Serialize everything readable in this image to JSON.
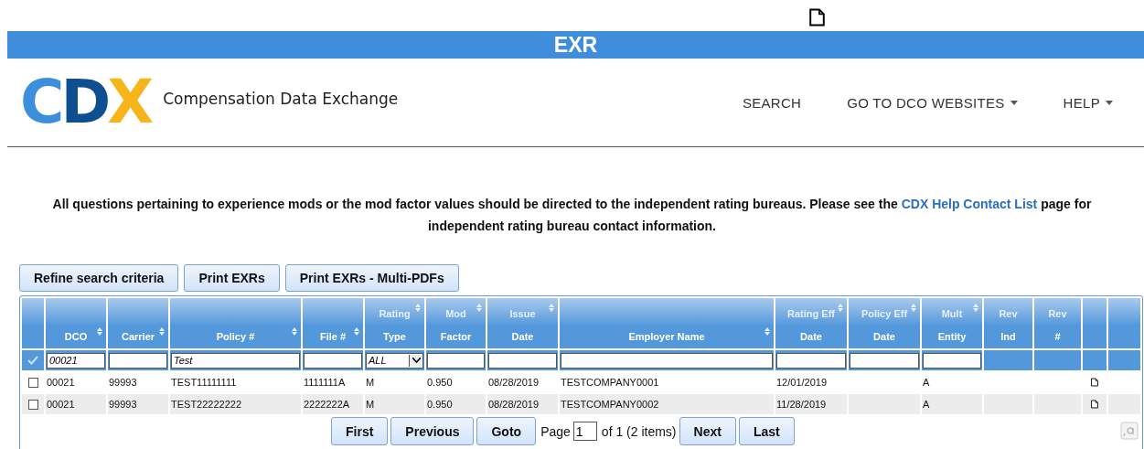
{
  "banner": {
    "title": "EXR"
  },
  "brand": {
    "logo": "CDX",
    "tagline": "Compensation Data Exchange"
  },
  "nav": [
    {
      "label": "SEARCH",
      "dropdown": false
    },
    {
      "label": "GO TO DCO WEBSITES",
      "dropdown": true
    },
    {
      "label": "HELP",
      "dropdown": true
    }
  ],
  "notice": {
    "before": "All questions pertaining to experience mods or the mod factor values should be directed to the independent rating bureaus. Please see the ",
    "link": "CDX Help Contact List",
    "after": " page for independent rating bureau contact information."
  },
  "actions": [
    "Refine search criteria",
    "Print EXRs",
    "Print EXRs - Multi-PDFs"
  ],
  "table": {
    "select_all": {
      "checked": true
    },
    "columns": [
      {
        "lines": [
          "DCO"
        ],
        "sortable": true,
        "filter": {
          "kind": "input",
          "value": "00021"
        }
      },
      {
        "lines": [
          "Carrier"
        ],
        "sortable": true,
        "filter": {
          "kind": "input"
        }
      },
      {
        "lines": [
          "Policy #"
        ],
        "sortable": true,
        "filter": {
          "kind": "input",
          "value": "Test"
        }
      },
      {
        "lines": [
          "File #"
        ],
        "sortable": true,
        "filter": {
          "kind": "input"
        }
      },
      {
        "lines": [
          "Rating",
          "Type"
        ],
        "sortable": true,
        "filter": {
          "kind": "select",
          "value": "ALL"
        }
      },
      {
        "lines": [
          "Mod",
          "Factor"
        ],
        "sortable": true,
        "filter": {
          "kind": "input"
        }
      },
      {
        "lines": [
          "Issue",
          "Date"
        ],
        "sortable": true,
        "filter": {
          "kind": "input"
        }
      },
      {
        "lines": [
          "Employer Name"
        ],
        "sortable": true,
        "filter": {
          "kind": "input"
        }
      },
      {
        "lines": [
          "Rating Eff",
          "Date"
        ],
        "sortable": true,
        "filter": {
          "kind": "input"
        }
      },
      {
        "lines": [
          "Policy Eff",
          "Date"
        ],
        "sortable": true,
        "filter": {
          "kind": "input"
        }
      },
      {
        "lines": [
          "Mult",
          "Entity"
        ],
        "sortable": true,
        "filter": {
          "kind": "input"
        }
      },
      {
        "lines": [
          "Rev",
          "Ind"
        ],
        "sortable": false,
        "filter": {
          "kind": "none"
        }
      },
      {
        "lines": [
          "Rev",
          "#"
        ],
        "sortable": false,
        "filter": {
          "kind": "none"
        }
      }
    ],
    "rows": [
      {
        "selected": false,
        "cells": [
          "00021",
          "99993",
          "TEST11111111",
          "1111111A",
          "M",
          "0.950",
          "08/28/2019",
          "TESTCOMPANY0001",
          "12/01/2019",
          "",
          "A",
          "",
          ""
        ],
        "document": true
      },
      {
        "selected": false,
        "cells": [
          "00021",
          "99993",
          "TEST22222222",
          "2222222A",
          "M",
          "0.950",
          "08/28/2019",
          "TESTCOMPANY0002",
          "11/28/2019",
          "",
          "A",
          "",
          ""
        ],
        "document": true
      }
    ]
  },
  "pager": {
    "buttons_before": [
      "First",
      "Previous",
      "Goto"
    ],
    "page_label": "Page",
    "page_value": "1",
    "page_total": "of 1 (2 items)",
    "buttons_after": [
      "Next",
      "Last"
    ]
  }
}
